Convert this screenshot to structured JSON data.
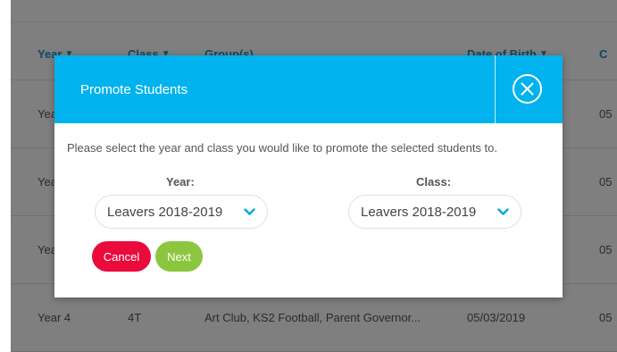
{
  "table": {
    "headers": [
      {
        "label": "Year",
        "chevron": true
      },
      {
        "label": "Class",
        "chevron": true
      },
      {
        "label": "Group(s)",
        "chevron": false
      },
      {
        "label": "Date of Birth",
        "chevron": true
      },
      {
        "label": "C",
        "chevron": false
      }
    ],
    "rows": [
      {
        "year": "Yea",
        "date2": "05"
      },
      {
        "year": "Yea",
        "date2": "05"
      },
      {
        "year": "Yea",
        "date2": "05"
      },
      {
        "year": "Year 4",
        "class": "4T",
        "groups": "Art Club, KS2 Football, Parent Governor...",
        "dob": "05/03/2019",
        "date2": "05"
      }
    ]
  },
  "modal": {
    "title": "Promote Students",
    "instructions": "Please select the year and class you would like to promote the selected students to.",
    "year_label": "Year:",
    "year_value": "Leavers 2018-2019",
    "class_label": "Class:",
    "class_value": "Leavers 2018-2019",
    "cancel_label": "Cancel",
    "next_label": "Next"
  },
  "icons": {
    "close": "close-circle-icon",
    "dropdown": "chevron-down-icon",
    "sort": "chevron-down-icon"
  },
  "colors": {
    "header_bg": "#00b2ee",
    "cancel": "#ea0a3c",
    "next": "#8cc63f",
    "link": "#1e8fc6"
  }
}
